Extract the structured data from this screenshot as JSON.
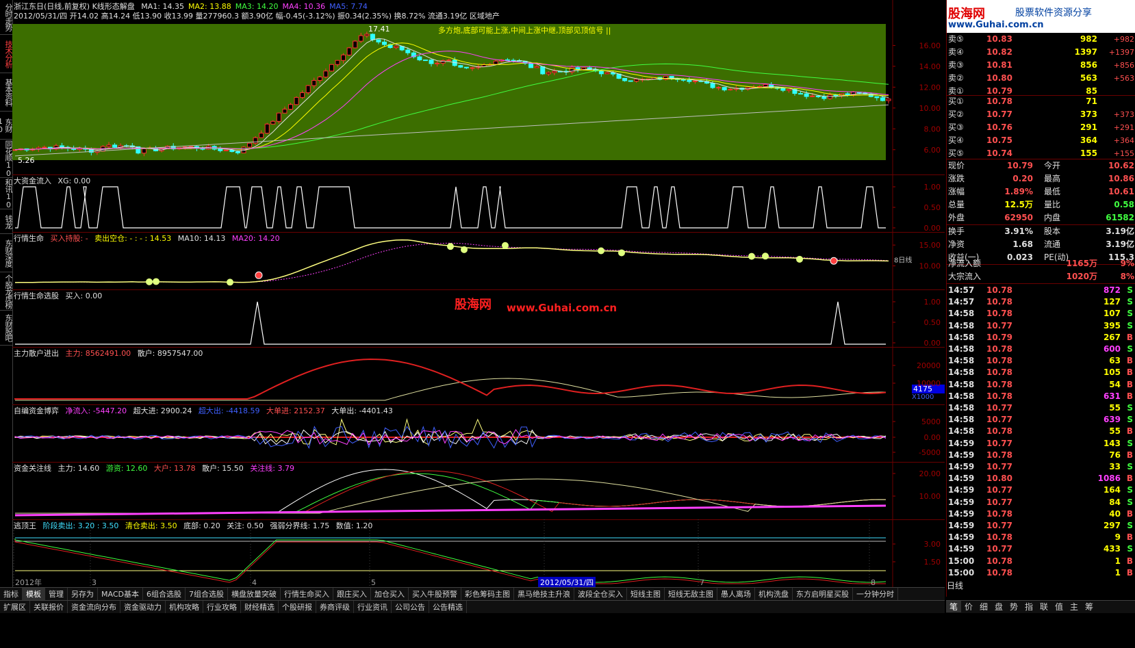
{
  "header": {
    "stock_title": "浙江东日(日线,前复权) K线形态解盘",
    "ma": [
      {
        "label": "MA1: 14.35",
        "color": "#e0e0e0"
      },
      {
        "label": "MA2: 13.88",
        "color": "#ffff00"
      },
      {
        "label": "MA3: 14.20",
        "color": "#40ff40"
      },
      {
        "label": "MA4: 10.36",
        "color": "#ff40ff"
      },
      {
        "label": "MA5: 7.74",
        "color": "#4060ff"
      }
    ],
    "info_line": "2012/05/31/四 开14.02 高14.24 低13.90 收13.99 量277960.3 额3.90亿 幅-0.45(-3.12%) 振0.34(2.35%) 换8.72% 流通3.19亿 区域地产"
  },
  "left_tabs": [
    "分时走势",
    "技术分析",
    "基本资料",
    "东财10",
    "同花顺10",
    "和讯10",
    "钱龙",
    "东财深度",
    "个股龙虎榜",
    "东财股吧"
  ],
  "main_chart": {
    "high_label": "17.41",
    "low_label": "5.26",
    "annotation": "多方炮,底部可能上涨,中间上涨中继,顶部见顶信号 ||",
    "y_ticks": [
      "16.00",
      "14.00",
      "12.00",
      "10.00",
      "8.00",
      "6.00"
    ]
  },
  "panes": {
    "p1": {
      "name": "大资金流入",
      "params": "XG: 0.00",
      "y_ticks": [
        "1.00",
        "0.50",
        "0.00"
      ]
    },
    "p2": {
      "name": "行情生命",
      "buy": "买入持股: -",
      "sell": "卖出空仓: - : - : 14.53",
      "ma10": "MA10: 14.13",
      "ma20": "MA20: 14.20",
      "y_ticks": [
        "15.00",
        "10.00"
      ],
      "side_label": "8日线"
    },
    "p3": {
      "name": "行情生命选股",
      "params": "买入: 0.00",
      "y_ticks": [
        "1.00",
        "0.50",
        "0.00"
      ],
      "watermark_cn": "股海网",
      "watermark_url": "www.Guhai.com.cn"
    },
    "p4": {
      "name": "主力散户进出",
      "main": "主力: 8562491.00",
      "retail": "散户: 8957547.00",
      "y_ticks": [
        "20000",
        "10000"
      ],
      "badge": "4175",
      "unit": "X1000"
    },
    "p5": {
      "name": "自编资金博弈",
      "net": "净流入: -5447.20",
      "super_in": "超大进: 2900.24",
      "super_out": "超大出: -4418.59",
      "big_in": "大单进: 2152.37",
      "big_out": "大单出: -4401.43",
      "y_ticks": [
        "5000",
        "0.00",
        "-5000"
      ]
    },
    "p6": {
      "name": "资金关注线",
      "main": "主力: 14.60",
      "hot": "游资: 12.60",
      "big": "大户: 13.78",
      "retail": "散户: 15.50",
      "focus": "关注线: 3.79",
      "y_ticks": [
        "20.00",
        "10.00"
      ]
    },
    "p7": {
      "name": "逃顶王",
      "stage_sell": "阶段卖出: 3.20 : 3.50",
      "clear": "清仓卖出: 3.50",
      "bottom": "底部: 0.20",
      "focus": "关注: 0.50",
      "strong": "强弱分界线: 1.75",
      "value": "数值: 1.20",
      "y_ticks": [
        "3.00",
        "1.50"
      ]
    }
  },
  "x_axis": {
    "labels": [
      "2012年",
      "3",
      "4",
      "5",
      "6",
      "7",
      "8"
    ],
    "cursor_date": "2012/05/31/四"
  },
  "bottom_tabs_row1": [
    "指标",
    "模板",
    "管理",
    "另存为",
    "MACD基本",
    "6组合选股",
    "7组合选股",
    "横盘放量突破",
    "行情生命买入",
    "跟庄买入",
    "加仓买入",
    "买入牛股预警",
    "彩色筹码主图",
    "黑马绝技主升浪",
    "波段全仓买入",
    "短线主图",
    "短线无敌主图",
    "愚人离场",
    "机构洗盘",
    "东方启明星买股",
    "一分钟分时"
  ],
  "bottom_tabs_row2": [
    "扩展区",
    "关联报价",
    "资金流向分布",
    "资金驱动力",
    "机构攻略",
    "行业攻略",
    "财经精选",
    "个股研报",
    "券商评级",
    "行业资讯",
    "公司公告",
    "公告精选"
  ],
  "right_panel": {
    "logo_main": "股海网",
    "logo_sub": "股票软件资源分享",
    "logo_url": "www.Guhai.com.cn",
    "asks": [
      {
        "label": "卖⑤",
        "price": "10.83",
        "vol": "982",
        "chg": "+982"
      },
      {
        "label": "卖④",
        "price": "10.82",
        "vol": "1397",
        "chg": "+1397"
      },
      {
        "label": "卖③",
        "price": "10.81",
        "vol": "856",
        "chg": "+856"
      },
      {
        "label": "卖②",
        "price": "10.80",
        "vol": "563",
        "chg": "+563"
      },
      {
        "label": "卖①",
        "price": "10.79",
        "vol": "85",
        "chg": ""
      }
    ],
    "bids": [
      {
        "label": "买①",
        "price": "10.78",
        "vol": "71",
        "chg": ""
      },
      {
        "label": "买②",
        "price": "10.77",
        "vol": "373",
        "chg": "+373"
      },
      {
        "label": "买③",
        "price": "10.76",
        "vol": "291",
        "chg": "+291"
      },
      {
        "label": "买④",
        "price": "10.75",
        "vol": "364",
        "chg": "+364"
      },
      {
        "label": "买⑤",
        "price": "10.74",
        "vol": "155",
        "chg": "+155"
      }
    ],
    "stats": [
      {
        "l1": "现价",
        "v1": "10.79",
        "c1": "#ff5050",
        "l2": "今开",
        "v2": "10.62",
        "c2": "#ff5050"
      },
      {
        "l1": "涨跌",
        "v1": "0.20",
        "c1": "#ff5050",
        "l2": "最高",
        "v2": "10.86",
        "c2": "#ff5050"
      },
      {
        "l1": "涨幅",
        "v1": "1.89%",
        "c1": "#ff5050",
        "l2": "最低",
        "v2": "10.61",
        "c2": "#ff5050"
      },
      {
        "l1": "总量",
        "v1": "12.5万",
        "c1": "#ffff00",
        "l2": "量比",
        "v2": "0.58",
        "c2": "#40ff40"
      },
      {
        "l1": "外盘",
        "v1": "62950",
        "c1": "#ff5050",
        "l2": "内盘",
        "v2": "61582",
        "c2": "#40ff40"
      }
    ],
    "stats2": [
      {
        "l1": "换手",
        "v1": "3.91%",
        "l2": "股本",
        "v2": "3.19亿"
      },
      {
        "l1": "净资",
        "v1": "1.68",
        "l2": "流通",
        "v2": "3.19亿"
      },
      {
        "l1": "收益(一)",
        "v1": "0.023",
        "l2": "PE(动)",
        "v2": "115.3"
      }
    ],
    "flows": [
      {
        "label": "净流入额",
        "value": "1165万",
        "pct": "9%"
      },
      {
        "label": "大宗流入",
        "value": "1020万",
        "pct": "8%"
      }
    ],
    "ticks": [
      {
        "t": "14:57",
        "p": "10.78",
        "v": "872",
        "s": "S",
        "vc": "#ff40ff"
      },
      {
        "t": "14:57",
        "p": "10.78",
        "v": "127",
        "s": "S",
        "vc": "#ffff00"
      },
      {
        "t": "14:58",
        "p": "10.78",
        "v": "107",
        "s": "S",
        "vc": "#ffff00"
      },
      {
        "t": "14:58",
        "p": "10.77",
        "v": "395",
        "s": "S",
        "vc": "#ffff00"
      },
      {
        "t": "14:58",
        "p": "10.79",
        "v": "267",
        "s": "B",
        "vc": "#ffff00"
      },
      {
        "t": "14:58",
        "p": "10.78",
        "v": "600",
        "s": "S",
        "vc": "#ff40ff"
      },
      {
        "t": "14:58",
        "p": "10.78",
        "v": "63",
        "s": "B",
        "vc": "#ffff00"
      },
      {
        "t": "14:58",
        "p": "10.78",
        "v": "105",
        "s": "B",
        "vc": "#ffff00"
      },
      {
        "t": "14:58",
        "p": "10.78",
        "v": "54",
        "s": "B",
        "vc": "#ffff00"
      },
      {
        "t": "14:58",
        "p": "10.78",
        "v": "631",
        "s": "B",
        "vc": "#ff40ff"
      },
      {
        "t": "14:58",
        "p": "10.77",
        "v": "55",
        "s": "S",
        "vc": "#ffff00"
      },
      {
        "t": "14:58",
        "p": "10.77",
        "v": "639",
        "s": "S",
        "vc": "#ff40ff"
      },
      {
        "t": "14:58",
        "p": "10.78",
        "v": "55",
        "s": "B",
        "vc": "#ffff00"
      },
      {
        "t": "14:59",
        "p": "10.77",
        "v": "143",
        "s": "S",
        "vc": "#ffff00"
      },
      {
        "t": "14:59",
        "p": "10.78",
        "v": "76",
        "s": "B",
        "vc": "#ffff00"
      },
      {
        "t": "14:59",
        "p": "10.77",
        "v": "33",
        "s": "S",
        "vc": "#ffff00"
      },
      {
        "t": "14:59",
        "p": "10.80",
        "v": "1086",
        "s": "B",
        "vc": "#ff40ff"
      },
      {
        "t": "14:59",
        "p": "10.77",
        "v": "164",
        "s": "S",
        "vc": "#ffff00"
      },
      {
        "t": "14:59",
        "p": "10.77",
        "v": "84",
        "s": "S",
        "vc": "#ffff00"
      },
      {
        "t": "14:59",
        "p": "10.78",
        "v": "40",
        "s": "B",
        "vc": "#ffff00"
      },
      {
        "t": "14:59",
        "p": "10.77",
        "v": "297",
        "s": "S",
        "vc": "#ffff00"
      },
      {
        "t": "14:59",
        "p": "10.78",
        "v": "9",
        "s": "B",
        "vc": "#ffff00"
      },
      {
        "t": "14:59",
        "p": "10.77",
        "v": "433",
        "s": "S",
        "vc": "#ffff00"
      },
      {
        "t": "15:00",
        "p": "10.78",
        "v": "1",
        "s": "B",
        "vc": "#ffff00"
      },
      {
        "t": "15:00",
        "p": "10.78",
        "v": "1",
        "s": "B",
        "vc": "#ffff00"
      }
    ],
    "period_label": "日线",
    "bottom_tabs": [
      "笔",
      "价",
      "细",
      "盘",
      "势",
      "指",
      "联",
      "值",
      "主",
      "筹"
    ]
  }
}
